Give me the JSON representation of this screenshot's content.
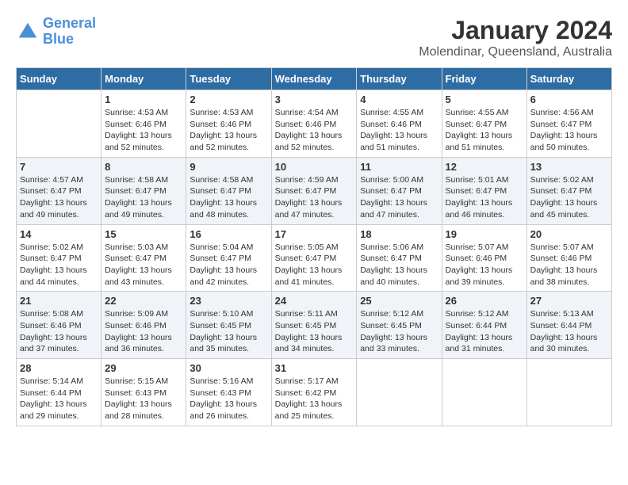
{
  "header": {
    "logo_line1": "General",
    "logo_line2": "Blue",
    "month_title": "January 2024",
    "location": "Molendinar, Queensland, Australia"
  },
  "days_of_week": [
    "Sunday",
    "Monday",
    "Tuesday",
    "Wednesday",
    "Thursday",
    "Friday",
    "Saturday"
  ],
  "weeks": [
    [
      {
        "day": "",
        "info": ""
      },
      {
        "day": "1",
        "info": "Sunrise: 4:53 AM\nSunset: 6:46 PM\nDaylight: 13 hours\nand 52 minutes."
      },
      {
        "day": "2",
        "info": "Sunrise: 4:53 AM\nSunset: 6:46 PM\nDaylight: 13 hours\nand 52 minutes."
      },
      {
        "day": "3",
        "info": "Sunrise: 4:54 AM\nSunset: 6:46 PM\nDaylight: 13 hours\nand 52 minutes."
      },
      {
        "day": "4",
        "info": "Sunrise: 4:55 AM\nSunset: 6:46 PM\nDaylight: 13 hours\nand 51 minutes."
      },
      {
        "day": "5",
        "info": "Sunrise: 4:55 AM\nSunset: 6:47 PM\nDaylight: 13 hours\nand 51 minutes."
      },
      {
        "day": "6",
        "info": "Sunrise: 4:56 AM\nSunset: 6:47 PM\nDaylight: 13 hours\nand 50 minutes."
      }
    ],
    [
      {
        "day": "7",
        "info": "Sunrise: 4:57 AM\nSunset: 6:47 PM\nDaylight: 13 hours\nand 49 minutes."
      },
      {
        "day": "8",
        "info": "Sunrise: 4:58 AM\nSunset: 6:47 PM\nDaylight: 13 hours\nand 49 minutes."
      },
      {
        "day": "9",
        "info": "Sunrise: 4:58 AM\nSunset: 6:47 PM\nDaylight: 13 hours\nand 48 minutes."
      },
      {
        "day": "10",
        "info": "Sunrise: 4:59 AM\nSunset: 6:47 PM\nDaylight: 13 hours\nand 47 minutes."
      },
      {
        "day": "11",
        "info": "Sunrise: 5:00 AM\nSunset: 6:47 PM\nDaylight: 13 hours\nand 47 minutes."
      },
      {
        "day": "12",
        "info": "Sunrise: 5:01 AM\nSunset: 6:47 PM\nDaylight: 13 hours\nand 46 minutes."
      },
      {
        "day": "13",
        "info": "Sunrise: 5:02 AM\nSunset: 6:47 PM\nDaylight: 13 hours\nand 45 minutes."
      }
    ],
    [
      {
        "day": "14",
        "info": "Sunrise: 5:02 AM\nSunset: 6:47 PM\nDaylight: 13 hours\nand 44 minutes."
      },
      {
        "day": "15",
        "info": "Sunrise: 5:03 AM\nSunset: 6:47 PM\nDaylight: 13 hours\nand 43 minutes."
      },
      {
        "day": "16",
        "info": "Sunrise: 5:04 AM\nSunset: 6:47 PM\nDaylight: 13 hours\nand 42 minutes."
      },
      {
        "day": "17",
        "info": "Sunrise: 5:05 AM\nSunset: 6:47 PM\nDaylight: 13 hours\nand 41 minutes."
      },
      {
        "day": "18",
        "info": "Sunrise: 5:06 AM\nSunset: 6:47 PM\nDaylight: 13 hours\nand 40 minutes."
      },
      {
        "day": "19",
        "info": "Sunrise: 5:07 AM\nSunset: 6:46 PM\nDaylight: 13 hours\nand 39 minutes."
      },
      {
        "day": "20",
        "info": "Sunrise: 5:07 AM\nSunset: 6:46 PM\nDaylight: 13 hours\nand 38 minutes."
      }
    ],
    [
      {
        "day": "21",
        "info": "Sunrise: 5:08 AM\nSunset: 6:46 PM\nDaylight: 13 hours\nand 37 minutes."
      },
      {
        "day": "22",
        "info": "Sunrise: 5:09 AM\nSunset: 6:46 PM\nDaylight: 13 hours\nand 36 minutes."
      },
      {
        "day": "23",
        "info": "Sunrise: 5:10 AM\nSunset: 6:45 PM\nDaylight: 13 hours\nand 35 minutes."
      },
      {
        "day": "24",
        "info": "Sunrise: 5:11 AM\nSunset: 6:45 PM\nDaylight: 13 hours\nand 34 minutes."
      },
      {
        "day": "25",
        "info": "Sunrise: 5:12 AM\nSunset: 6:45 PM\nDaylight: 13 hours\nand 33 minutes."
      },
      {
        "day": "26",
        "info": "Sunrise: 5:12 AM\nSunset: 6:44 PM\nDaylight: 13 hours\nand 31 minutes."
      },
      {
        "day": "27",
        "info": "Sunrise: 5:13 AM\nSunset: 6:44 PM\nDaylight: 13 hours\nand 30 minutes."
      }
    ],
    [
      {
        "day": "28",
        "info": "Sunrise: 5:14 AM\nSunset: 6:44 PM\nDaylight: 13 hours\nand 29 minutes."
      },
      {
        "day": "29",
        "info": "Sunrise: 5:15 AM\nSunset: 6:43 PM\nDaylight: 13 hours\nand 28 minutes."
      },
      {
        "day": "30",
        "info": "Sunrise: 5:16 AM\nSunset: 6:43 PM\nDaylight: 13 hours\nand 26 minutes."
      },
      {
        "day": "31",
        "info": "Sunrise: 5:17 AM\nSunset: 6:42 PM\nDaylight: 13 hours\nand 25 minutes."
      },
      {
        "day": "",
        "info": ""
      },
      {
        "day": "",
        "info": ""
      },
      {
        "day": "",
        "info": ""
      }
    ]
  ]
}
